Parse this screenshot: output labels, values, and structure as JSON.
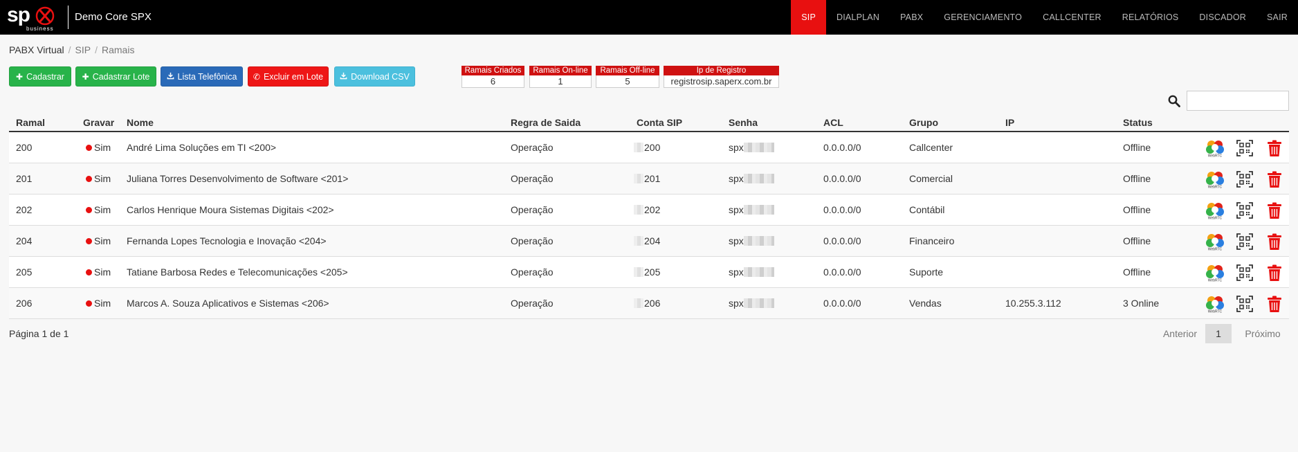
{
  "header": {
    "logo_text": "sp",
    "logo_sub": "business",
    "brand": "Demo Core SPX",
    "nav": [
      {
        "label": "SIP",
        "active": true
      },
      {
        "label": "DIALPLAN"
      },
      {
        "label": "PABX"
      },
      {
        "label": "GERENCIAMENTO"
      },
      {
        "label": "CALLCENTER"
      },
      {
        "label": "RELATÓRIOS"
      },
      {
        "label": "DISCADOR"
      },
      {
        "label": "SAIR"
      }
    ]
  },
  "breadcrumb": [
    "PABX Virtual",
    "SIP",
    "Ramais"
  ],
  "toolbar": {
    "cadastrar": "Cadastrar",
    "cadastrar_lote": "Cadastrar Lote",
    "lista_telefonica": "Lista Telefônica",
    "excluir_lote": "Excluir em Lote",
    "download_csv": "Download CSV"
  },
  "stats": [
    {
      "label": "Ramais Criados",
      "value": "6"
    },
    {
      "label": "Ramais On-line",
      "value": "1"
    },
    {
      "label": "Ramais Off-line",
      "value": "5"
    },
    {
      "label": "Ip de Registro",
      "value": "registrosip.saperx.com.br"
    }
  ],
  "search": {
    "value": ""
  },
  "table": {
    "columns": [
      "Ramal",
      "Gravar",
      "Nome",
      "Regra de Saida",
      "Conta SIP",
      "Senha",
      "ACL",
      "Grupo",
      "IP",
      "Status"
    ],
    "rows": [
      {
        "ramal": "200",
        "gravar": "Sim",
        "nome": "André Lima Soluções em TI <200>",
        "regra": "Operação",
        "conta": "200",
        "senha": "spx",
        "acl": "0.0.0.0/0",
        "grupo": "Callcenter",
        "ip": "",
        "status": "Offline"
      },
      {
        "ramal": "201",
        "gravar": "Sim",
        "nome": "Juliana Torres Desenvolvimento de Software <201>",
        "regra": "Operação",
        "conta": "201",
        "senha": "spx",
        "acl": "0.0.0.0/0",
        "grupo": "Comercial",
        "ip": "",
        "status": "Offline"
      },
      {
        "ramal": "202",
        "gravar": "Sim",
        "nome": "Carlos Henrique Moura Sistemas Digitais <202>",
        "regra": "Operação",
        "conta": "202",
        "senha": "spx",
        "acl": "0.0.0.0/0",
        "grupo": "Contábil",
        "ip": "",
        "status": "Offline"
      },
      {
        "ramal": "204",
        "gravar": "Sim",
        "nome": "Fernanda Lopes Tecnologia e Inovação <204>",
        "regra": "Operação",
        "conta": "204",
        "senha": "spx",
        "acl": "0.0.0.0/0",
        "grupo": "Financeiro",
        "ip": "",
        "status": "Offline"
      },
      {
        "ramal": "205",
        "gravar": "Sim",
        "nome": "Tatiane Barbosa Redes e Telecomunicações <205>",
        "regra": "Operação",
        "conta": "205",
        "senha": "spx",
        "acl": "0.0.0.0/0",
        "grupo": "Suporte",
        "ip": "",
        "status": "Offline"
      },
      {
        "ramal": "206",
        "gravar": "Sim",
        "nome": "Marcos A. Souza Aplicativos e Sistemas <206>",
        "regra": "Operação",
        "conta": "206",
        "senha": "spx",
        "acl": "0.0.0.0/0",
        "grupo": "Vendas",
        "ip": "10.255.3.112",
        "status": "3 Online"
      }
    ],
    "webrtc_label": "WebRTC"
  },
  "footer": {
    "page_info": "Página 1 de 1",
    "prev": "Anterior",
    "current": "1",
    "next": "Próximo"
  },
  "colors": {
    "accent": "#e81010",
    "topbar": "#000000"
  }
}
